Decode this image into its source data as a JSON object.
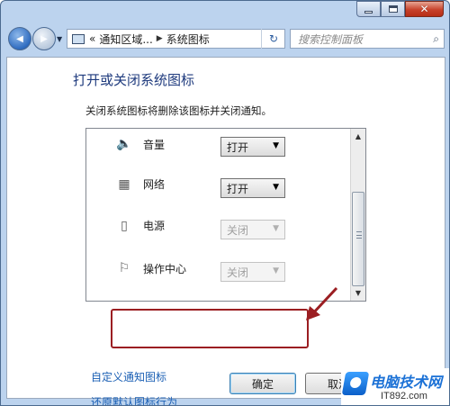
{
  "window": {
    "caption": {
      "minimize": "–",
      "maximize": "□",
      "close": "✕"
    }
  },
  "nav": {
    "back_glyph": "◀",
    "forward_glyph": "▶",
    "address": {
      "prefix": "«",
      "segment1": "通知区域...",
      "sep": "▶",
      "segment2": "系统图标"
    },
    "refresh_glyph": "↻",
    "search_placeholder": "搜索控制面板"
  },
  "page": {
    "title": "打开或关闭系统图标",
    "description": "关闭系统图标将删除该图标并关闭通知。"
  },
  "icons_list": [
    {
      "icon": "speaker-icon",
      "glyph": "🔈",
      "label": "音量",
      "value": "打开",
      "enabled": true
    },
    {
      "icon": "network-icon",
      "glyph": "▦",
      "label": "网络",
      "value": "打开",
      "enabled": true
    },
    {
      "icon": "power-icon",
      "glyph": "▯",
      "label": "电源",
      "value": "关闭",
      "enabled": false
    },
    {
      "icon": "flag-icon",
      "glyph": "⚐",
      "label": "操作中心",
      "value": "关闭",
      "enabled": false
    }
  ],
  "links": {
    "customize": "自定义通知图标",
    "restore": "还原默认图标行为"
  },
  "buttons": {
    "ok": "确定",
    "cancel": "取消"
  },
  "watermark": {
    "title": "电脑技术网",
    "url": "IT892.com"
  },
  "colors": {
    "title_blue": "#1e3a7d",
    "link_blue": "#1a5fb4",
    "highlight_red": "#9b1e22"
  }
}
